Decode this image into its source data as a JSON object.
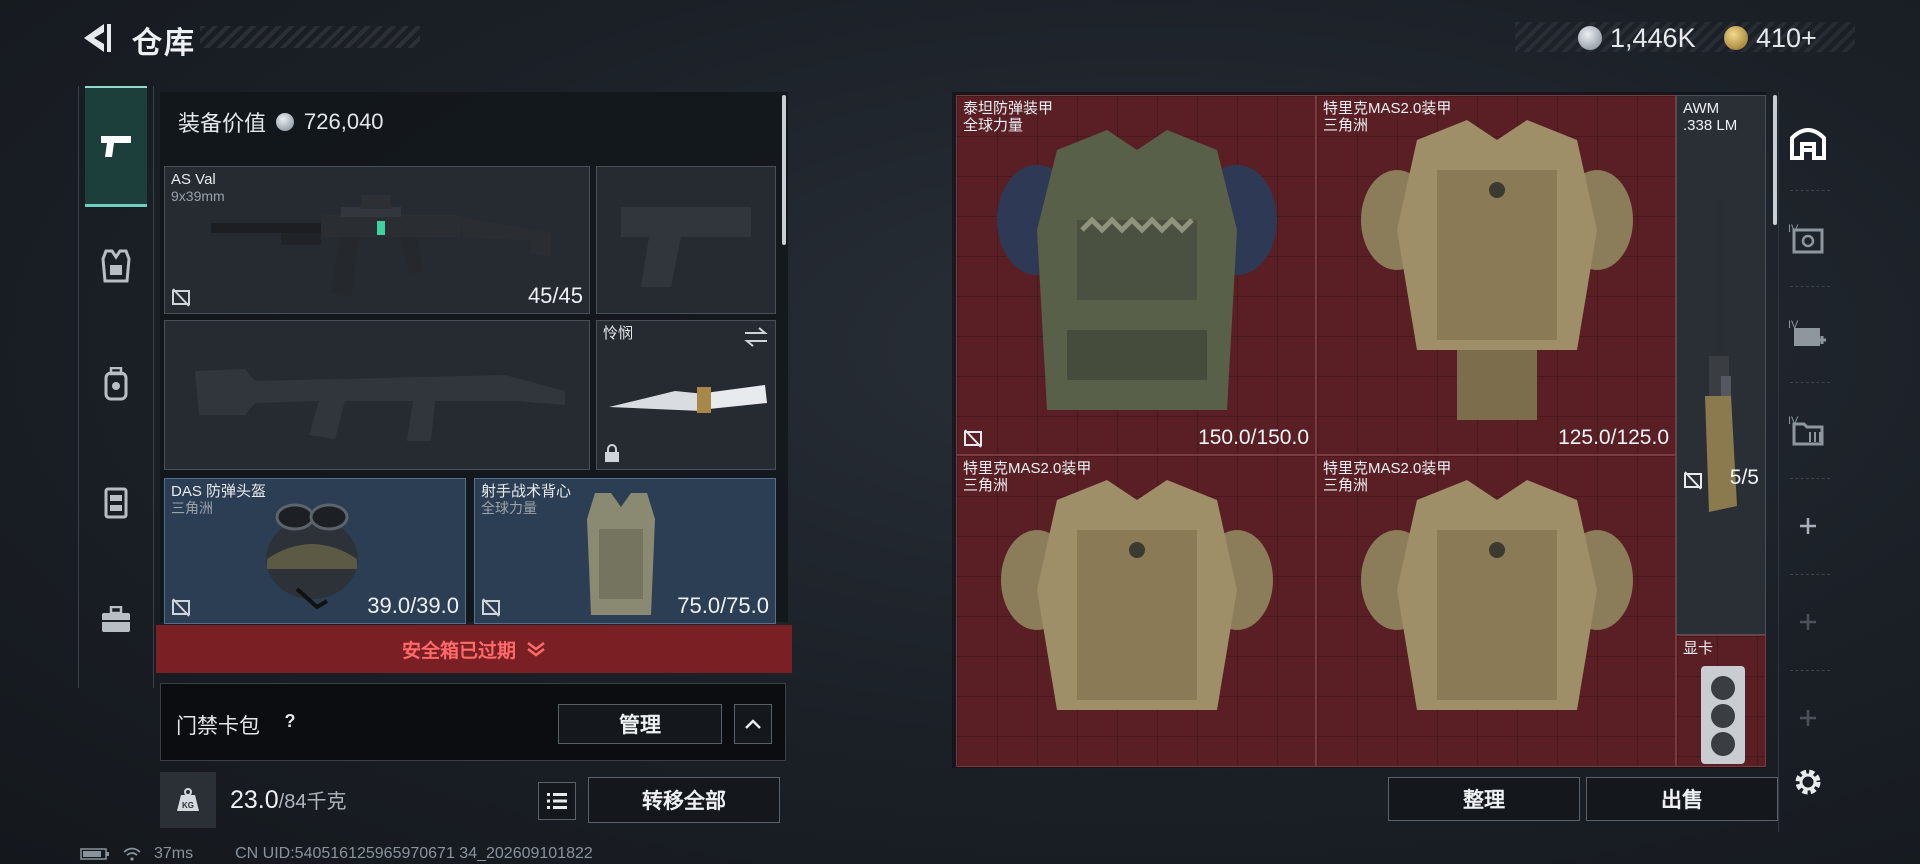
{
  "header": {
    "title": "仓库",
    "currency_silver": "1,446K",
    "currency_gold": "410+"
  },
  "category_tabs": [
    {
      "id": "weapons",
      "icon": "pistol-icon",
      "active": true
    },
    {
      "id": "armor",
      "icon": "vest-icon"
    },
    {
      "id": "backpack",
      "icon": "backpack-icon"
    },
    {
      "id": "rig",
      "icon": "chest-rig-icon"
    },
    {
      "id": "case",
      "icon": "toolbox-icon"
    }
  ],
  "loadout": {
    "equipment_value_label": "装备价值",
    "equipment_value": "726,040",
    "primary_weapon": {
      "name": "AS Val",
      "caliber": "9x39mm",
      "ammo": "45/45"
    },
    "melee": {
      "name": "怜悯"
    },
    "helmet": {
      "name": "DAS 防弹头盔",
      "faction": "三角洲",
      "durability": "39.0/39.0"
    },
    "vest": {
      "name": "射手战术背心",
      "faction": "全球力量",
      "durability": "75.0/75.0"
    },
    "safebox_status": "安全箱已过期",
    "keycard_label": "门禁卡包",
    "keycard_help": "?",
    "manage_label": "管理",
    "weight_current": "23.0",
    "weight_max": "/84千克",
    "transfer_all_label": "转移全部"
  },
  "storage": {
    "items": [
      {
        "name": "泰坦防弹装甲",
        "sub": "全球力量",
        "durability": "150.0/150.0"
      },
      {
        "name": "特里克MAS2.0装甲",
        "sub": "三角洲",
        "durability": "125.0/125.0"
      },
      {
        "name": "AWM",
        "sub": ".338 LM",
        "ammo": "5/5"
      },
      {
        "name": "特里克MAS2.0装甲",
        "sub": "三角洲"
      },
      {
        "name": "特里克MAS2.0装甲",
        "sub": "三角洲"
      },
      {
        "name": "显卡",
        "sub": ""
      }
    ],
    "sort_label": "整理",
    "sell_label": "出售"
  },
  "status": {
    "ping": "37ms",
    "uid": "CN UID:540516125965970671 34_202609101822"
  },
  "colors": {
    "accent_teal": "#6fd0c2",
    "storage_red": "#5a1f25",
    "expired_red": "#7a1f23"
  }
}
